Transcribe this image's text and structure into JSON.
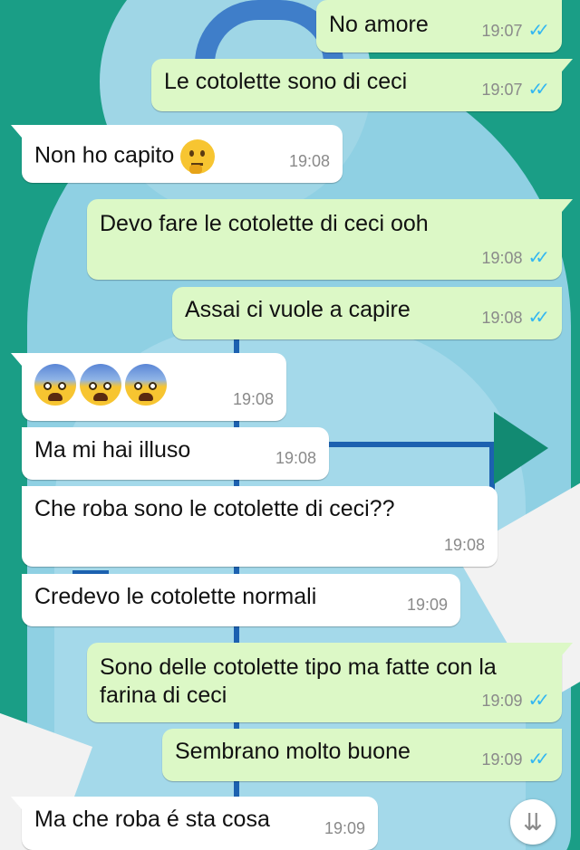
{
  "colors": {
    "wallpaper": "#1a9e86",
    "outgoing_bubble": "#dcf8c6",
    "incoming_bubble": "#ffffff",
    "read_ticks": "#34b7f1",
    "timestamp": "#8a8a8a"
  },
  "messages": [
    {
      "direction": "out",
      "text": "No amore",
      "time": "19:07",
      "status": "read"
    },
    {
      "direction": "out",
      "text": "Le cotolette sono di ceci",
      "time": "19:07",
      "status": "read"
    },
    {
      "direction": "in",
      "text": "Non ho capito",
      "emoji": [
        "thinking-face"
      ],
      "time": "19:08"
    },
    {
      "direction": "out",
      "text": "Devo fare le cotolette di ceci ooh",
      "time": "19:08",
      "status": "read"
    },
    {
      "direction": "out",
      "text": "Assai ci vuole a capire",
      "time": "19:08",
      "status": "read"
    },
    {
      "direction": "in",
      "text": "",
      "emoji": [
        "fearful-face",
        "fearful-face",
        "fearful-face"
      ],
      "time": "19:08"
    },
    {
      "direction": "in",
      "text": "Ma mi hai illuso",
      "time": "19:08"
    },
    {
      "direction": "in",
      "text": "Che roba sono le cotolette di ceci??",
      "time": "19:08"
    },
    {
      "direction": "in",
      "text": "Credevo le cotolette normali",
      "time": "19:09"
    },
    {
      "direction": "out",
      "text": "Sono delle cotolette tipo ma fatte con la farina di ceci",
      "time": "19:09",
      "status": "read"
    },
    {
      "direction": "out",
      "text": "Sembrano molto buone",
      "time": "19:09",
      "status": "read"
    },
    {
      "direction": "in",
      "text": "Ma che roba é sta cosa",
      "time": "19:09"
    }
  ],
  "scroll_button": {
    "icon": "double-chevron-down-icon"
  }
}
